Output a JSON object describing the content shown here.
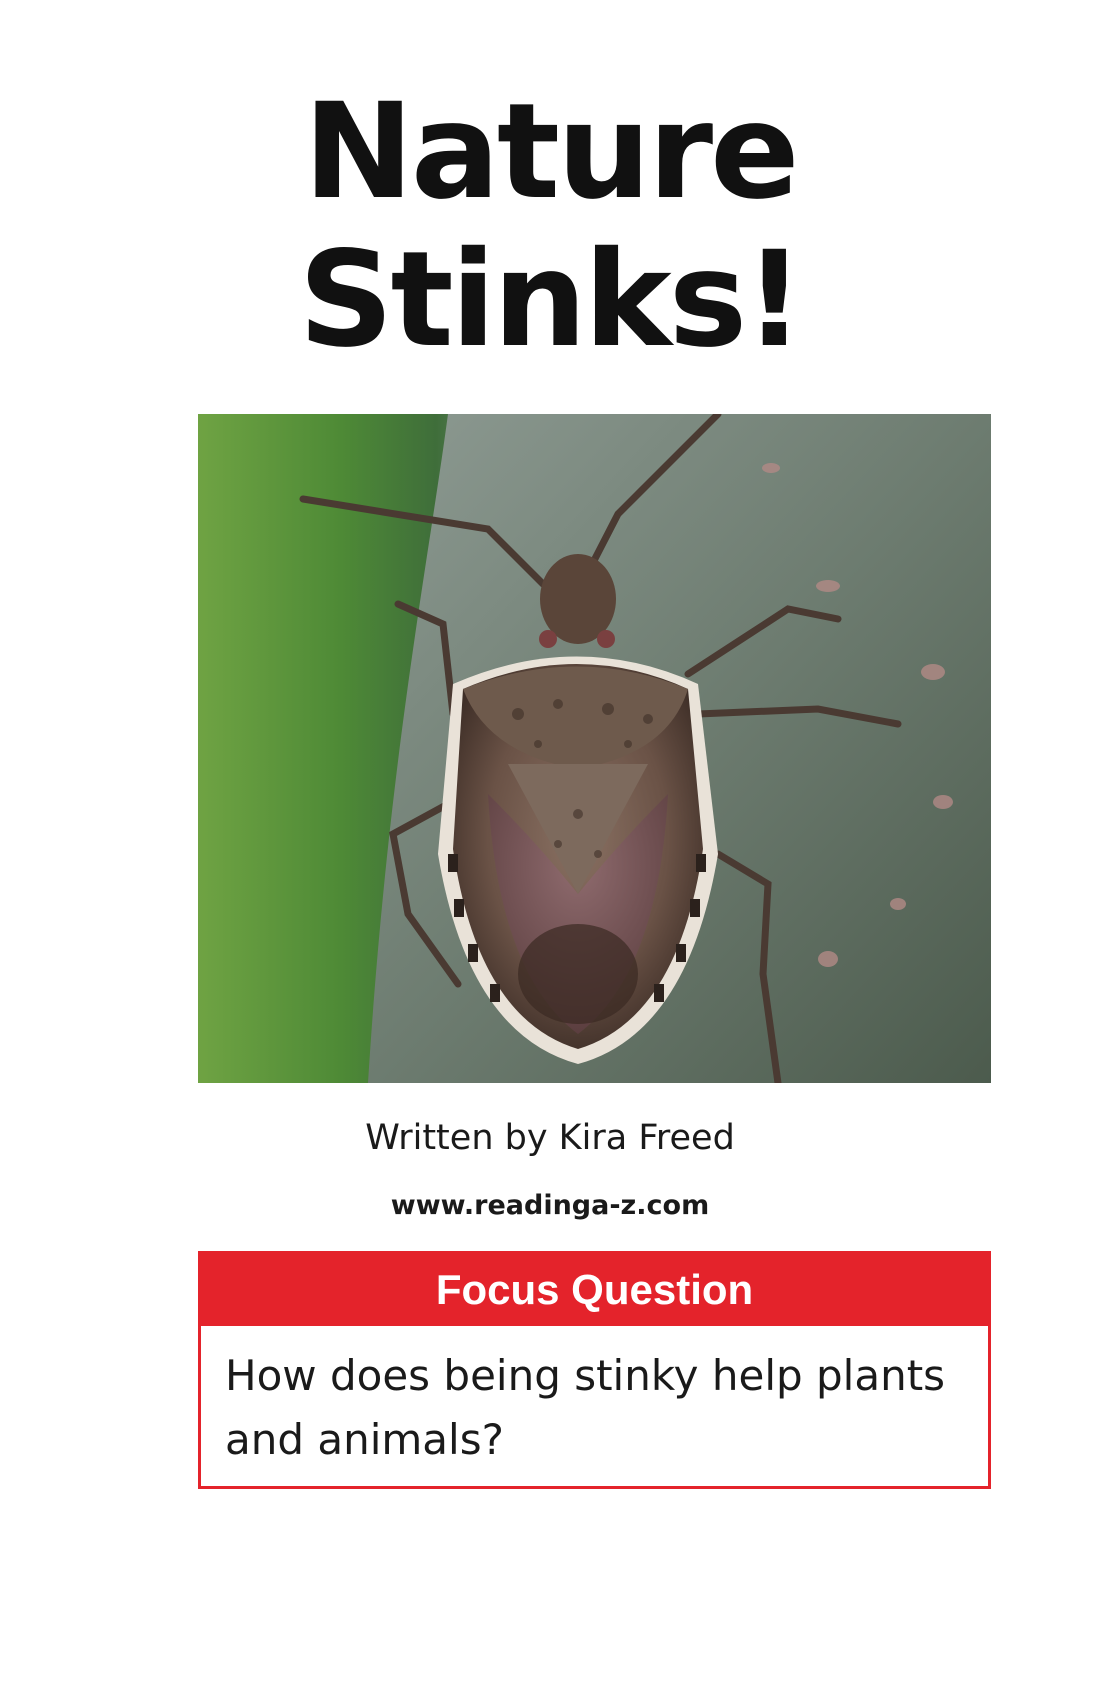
{
  "cover": {
    "title_line1": "Nature",
    "title_line2": "Stinks!",
    "byline": "Written by Kira Freed",
    "website": "www.readinga-z.com"
  },
  "photo": {
    "subject": "stink-bug-on-bark"
  },
  "focus": {
    "heading": "Focus Question",
    "question": "How does being stinky help plants and animals?"
  },
  "colors": {
    "accent": "#e4232b",
    "text": "#1a1a1a",
    "background": "#ffffff"
  }
}
